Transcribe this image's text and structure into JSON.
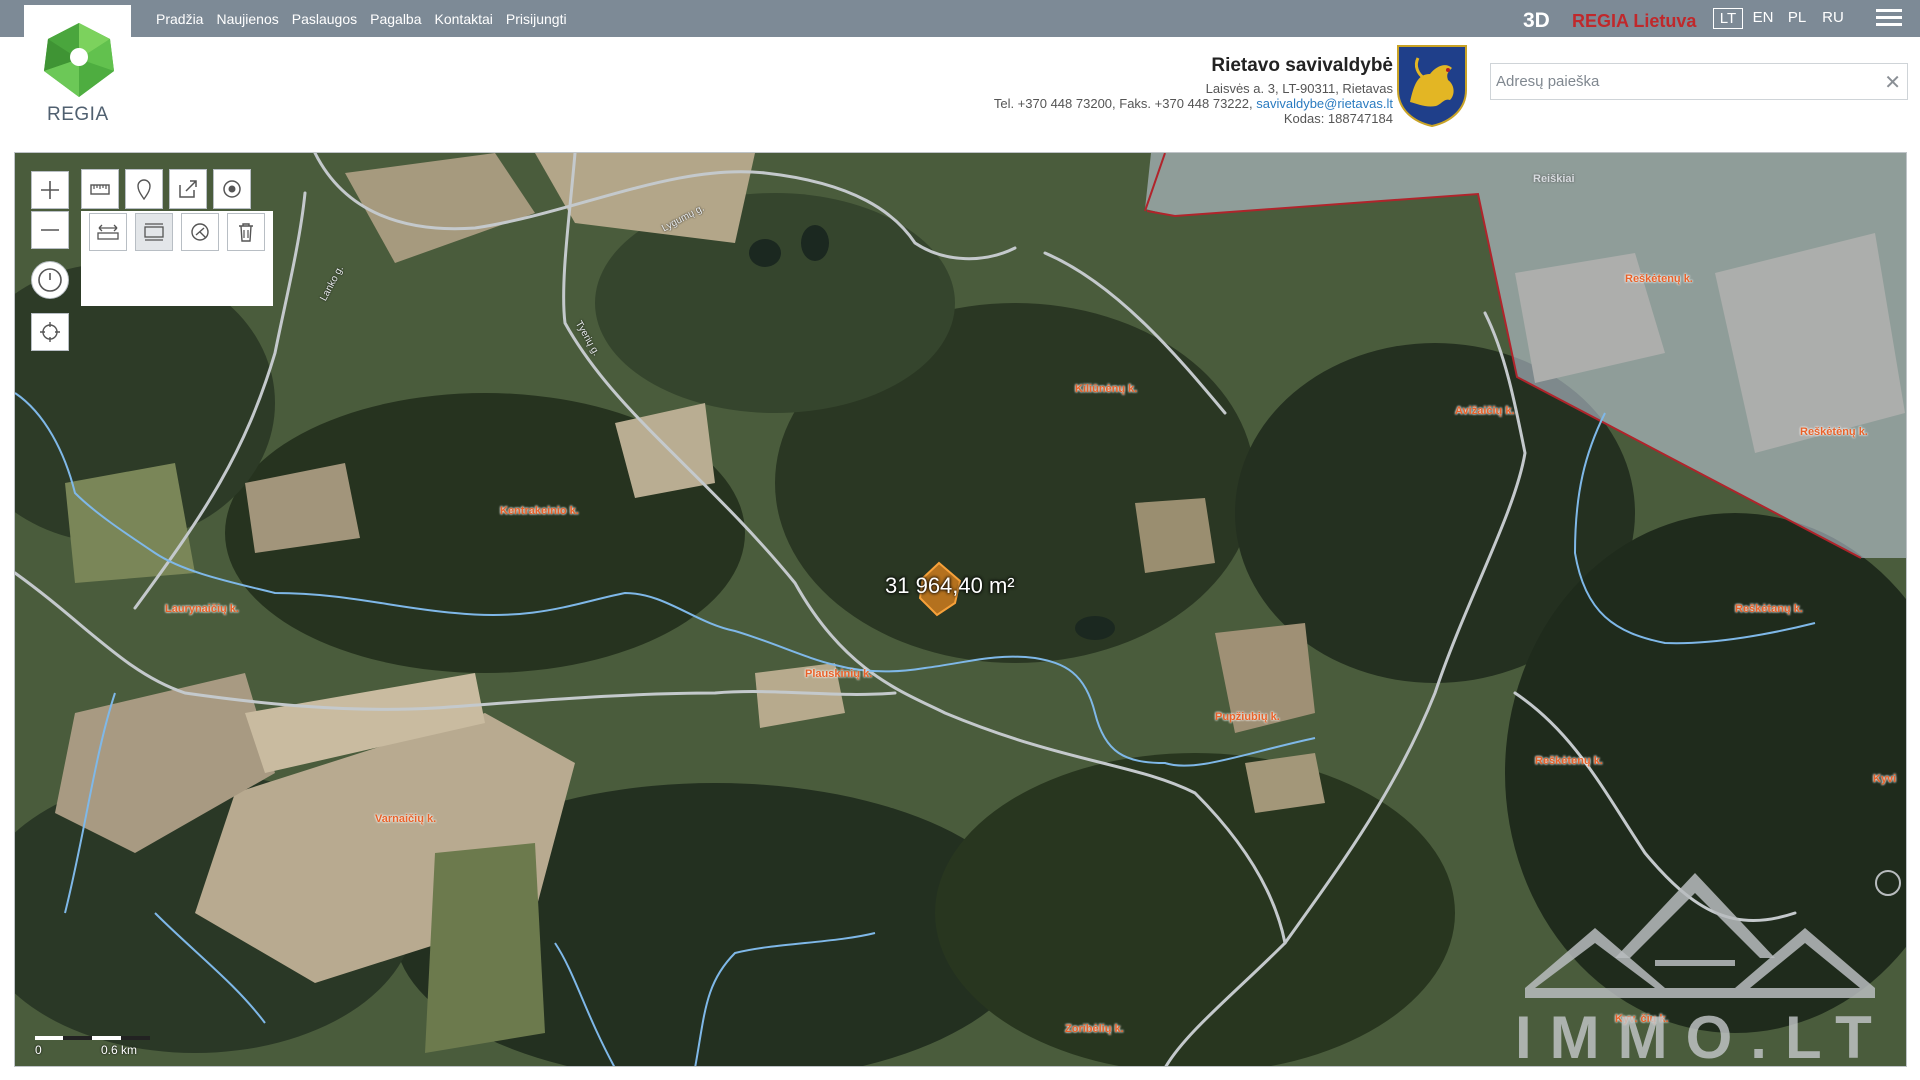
{
  "nav": {
    "items": [
      "Pradžia",
      "Naujienos",
      "Paslaugos",
      "Pagalba",
      "Kontaktai",
      "Prisijungti"
    ],
    "btn_3d": "3D",
    "brand": "REGIA Lietuva",
    "languages": [
      "LT",
      "EN",
      "PL",
      "RU"
    ],
    "active_language": "LT"
  },
  "logo": {
    "text": "REGIA"
  },
  "municipality": {
    "name": "Rietavo savivaldybė",
    "address": "Laisvės a. 3, LT-90311, Rietavas",
    "phone_prefix": "Tel. +370 448 73200, Faks. +370 448 73222,",
    "email": "savivaldybe@rietavas.lt",
    "code": "Kodas: 188747184"
  },
  "search": {
    "placeholder": "Adresų paieška",
    "clear_symbol": "✕"
  },
  "map": {
    "area_label": "31 964,40 m²",
    "places": {
      "reiskiai": "Reiškiai",
      "reskeetenu_top": "Reškėtenų k.",
      "kiliunu": "Kiliūnėnų k.",
      "avizaiciu": "Avižaičių k.",
      "reskeetenu_right": "Reškėtėnų k.",
      "kentrakeinio": "Kentrakeinio k.",
      "lauryneliu": "Laurynaičių k.",
      "reskeetanu": "Reškėtanų k.",
      "plauskiniu": "Plauskinių k.",
      "pupziubiu": "Pupžiubių k.",
      "reskeetenu_bottom": "Reškėtenų k.",
      "kyv_right": "Kyvi",
      "varnaiciu": "Varnaičių k.",
      "kyv_bottom": "Kyv. čių k.",
      "zoribeliu": "Zoribėlių k."
    },
    "streets": {
      "lygumu": "Lygumų g.",
      "lanko": "Lanko g.",
      "tyeriu": "Tyerių g."
    },
    "scale": {
      "zero": "0",
      "distance": "0.6 km"
    },
    "watermark": "IMMO.LT",
    "colors": {
      "boundary": "#b0242b",
      "river": "#7fb8e8",
      "road": "#c4c9cc",
      "label": "#e8622a",
      "parcel": "#f08a1c"
    }
  },
  "tools": {
    "zoom_in": "plus-icon",
    "zoom_out": "minus-icon",
    "measure": "ruler-icon",
    "marker": "map-marker-icon",
    "share": "share-icon",
    "target": "target-icon",
    "measure_distance": "measure-distance-icon",
    "measure_area": "measure-area-icon",
    "buffer": "buffer-icon",
    "delete": "trash-icon",
    "history": "clock-icon",
    "locate": "crosshair-icon"
  }
}
